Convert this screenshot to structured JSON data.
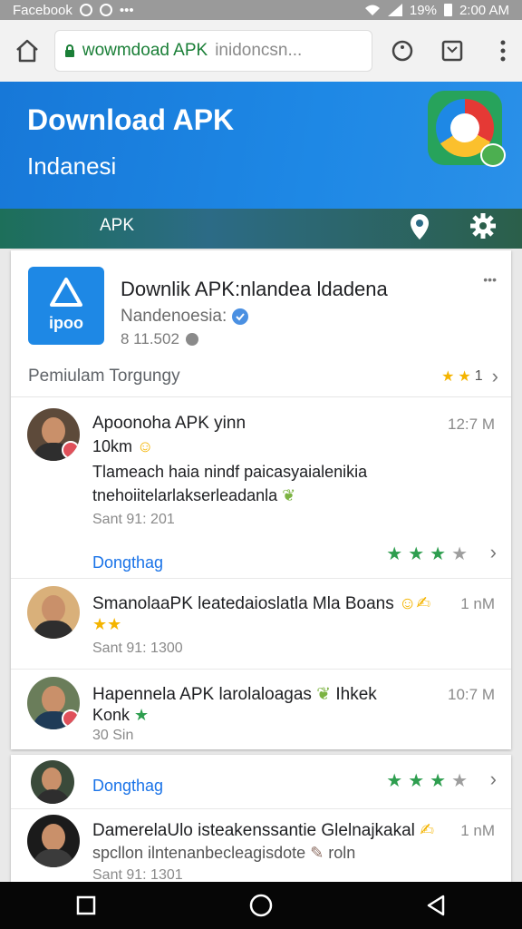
{
  "status_bar": {
    "left_label": "Facebook",
    "battery": "19%",
    "clock": "2:00 AM"
  },
  "browser": {
    "url_domain": "wowmdoad APK",
    "url_path": "inidoncsn...",
    "icons": [
      "home-icon",
      "lock-icon",
      "reload-icon",
      "tabs-icon",
      "overflow-menu-icon"
    ]
  },
  "hero": {
    "title": "Download APK",
    "subtitle": "Indanesi",
    "colors": {
      "blue": "#1e88e5",
      "logo_green": "#27a35b"
    }
  },
  "subnav": {
    "label": "APK"
  },
  "app": {
    "title": "Downlik APK:nlandea ldadena",
    "developer": "Nandenoesia:",
    "downloads": "8 11.502",
    "icon_text": "ipoo",
    "section_label": "Pemiulam Torgungy",
    "section_count": "1"
  },
  "reviews": [
    {
      "name": "Apoonoha APK yinn",
      "time": "12:7 M",
      "sub": "10km",
      "body1": "Tlameach haia nindf paicasyaialenikia",
      "body2": "tnehoiitelarlakserleadanla",
      "meta": "Sant 91: 201",
      "reply_label": "Dongthag"
    },
    {
      "name": "SmanolaaPK leatedaioslatla Mla Boans",
      "time": "1 nM",
      "meta": "Sant 91: 1300"
    },
    {
      "name": "Hapennela APK larolaloagas",
      "name_suffix": "Ihkek",
      "time": "10:7 M",
      "sub": "Konk",
      "meta": "30 Sin"
    }
  ],
  "card2": {
    "reply_label": "Dongthag",
    "review": {
      "name": "DamerelaUlo isteakenssantie Glelnajkakal",
      "time": "1 nM",
      "body1": "spcllon ilntenanbecleagisdote",
      "body1_suffix": "roln",
      "meta": "Sant 91: 1301"
    }
  }
}
